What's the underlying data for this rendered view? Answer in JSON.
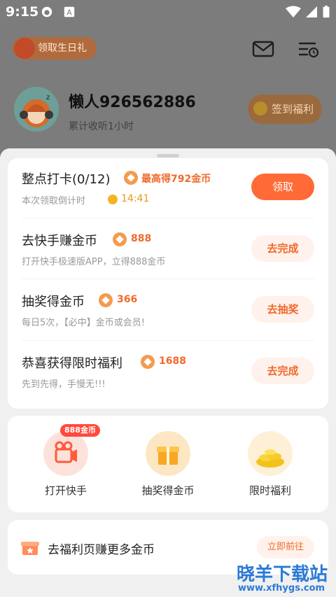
{
  "status_bar": {
    "time": "9:15"
  },
  "header": {
    "birthday_label": "领取生日礼",
    "username": "懒人926562886",
    "listen_time": "累计收听1小时",
    "signin_label": "签到福利"
  },
  "tasks": [
    {
      "title": "整点打卡(0/12)",
      "reward": "最高得792金币",
      "subtitle": "本次领取倒计时",
      "countdown": "14:41",
      "button": "领取"
    },
    {
      "title": "去快手赚金币",
      "reward": "888",
      "subtitle": "打开快手极速版APP，立得888金币",
      "button": "去完成"
    },
    {
      "title": "抽奖得金币",
      "reward": "366",
      "subtitle": "每日5次，【必中】金币或会员!",
      "button": "去抽奖"
    },
    {
      "title": "恭喜获得限时福利",
      "reward": "1688",
      "subtitle": "先到先得，手慢无!!!",
      "button": "去完成"
    }
  ],
  "quick_actions": [
    {
      "label": "打开快手",
      "badge": "888金币",
      "icon": "video-camera-icon"
    },
    {
      "label": "抽奖得金币",
      "icon": "gift-box-icon"
    },
    {
      "label": "限时福利",
      "icon": "gold-coins-icon"
    }
  ],
  "banner": {
    "title": "去福利页赚更多金币",
    "button": "立即前往"
  },
  "watermark": {
    "title": "晓羊下载站",
    "url": "www.xfhygs.com"
  },
  "colors": {
    "accent": "#ff6a36",
    "reward_text": "#f06a2b",
    "overlay": "#7c7c7c"
  }
}
